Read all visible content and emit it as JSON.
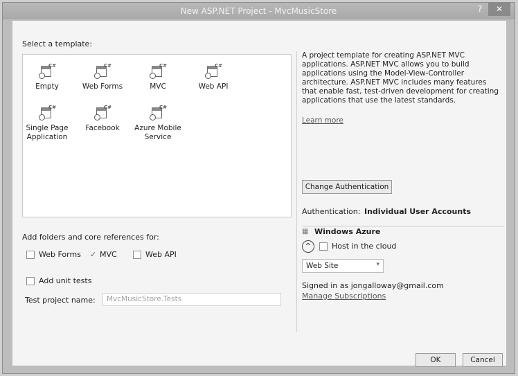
{
  "window": {
    "title": "New ASP.NET Project - MvcMusicStore",
    "help_label": "?",
    "close_label": "✕"
  },
  "templates_section": {
    "label": "Select a template:",
    "items": [
      {
        "label": "Empty",
        "icon": "web-template-icon"
      },
      {
        "label": "Web Forms",
        "icon": "web-template-icon"
      },
      {
        "label": "MVC",
        "icon": "web-template-icon"
      },
      {
        "label": "Web API",
        "icon": "web-template-icon"
      },
      {
        "label": "Single Page Application",
        "icon": "web-template-icon"
      },
      {
        "label": "Facebook",
        "icon": "web-template-icon"
      },
      {
        "label": "Azure Mobile Service",
        "icon": "web-template-icon"
      }
    ],
    "icon_badge": "C#"
  },
  "references": {
    "label": "Add folders and core references for:",
    "web_forms": "Web Forms",
    "mvc": "MVC",
    "mvc_checked": true,
    "web_api": "Web API"
  },
  "unit_tests": {
    "label": "Add unit tests",
    "project_name_label": "Test project name:",
    "project_name_value": "MvcMusicStore.Tests"
  },
  "description": {
    "text": "A project template for creating ASP.NET MVC applications. ASP.NET MVC allows you to build applications using the Model-View-Controller architecture. ASP.NET MVC includes many features that enable fast, test-driven development for creating applications that use the latest standards.",
    "learn_more": "Learn more"
  },
  "authentication": {
    "change_button": "Change Authentication",
    "label": "Authentication:",
    "value": "Individual User Accounts"
  },
  "azure": {
    "heading": "Windows Azure",
    "host_label": "Host in the cloud",
    "collapse_glyph": "^",
    "site_type": "Web Site",
    "signed_in": "Signed in as jongalloway@gmail.com",
    "manage_link": "Manage Subscriptions"
  },
  "footer": {
    "ok": "OK",
    "cancel": "Cancel"
  }
}
